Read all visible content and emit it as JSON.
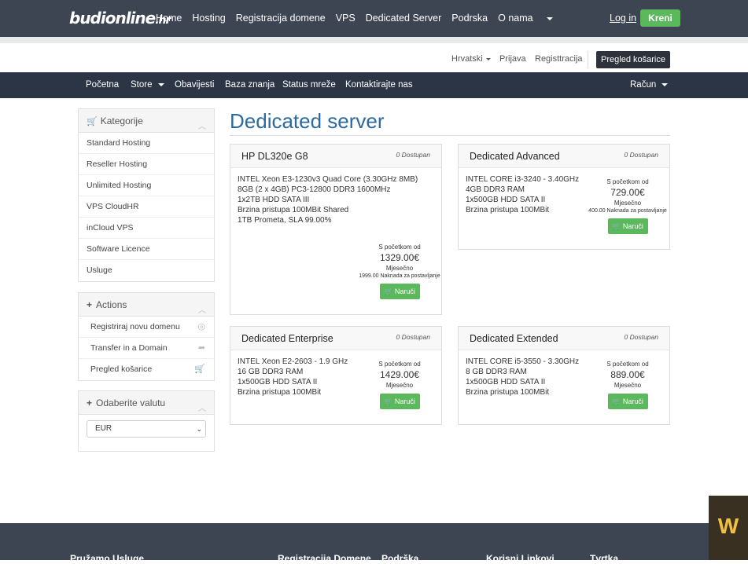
{
  "topnav": {
    "logo_main": "budionline",
    "logo_tld": ".hr",
    "menu": [
      "Home",
      "Hosting",
      "Registracija domene",
      "VPS",
      "Dedicated Server",
      "Podrska",
      "O nama"
    ],
    "login": "Log in",
    "cta": "Kreni"
  },
  "utilbar": {
    "language": "Hrvatski",
    "signin": "Prijava",
    "register": "Registtracija",
    "cart": "Pregled košarice"
  },
  "mainnav": {
    "items": [
      "Početna",
      "Store",
      "Obavijesti",
      "Baza znanja",
      "Status mreže",
      "Kontaktirajte nas"
    ],
    "account": "Račun"
  },
  "sidebar": {
    "categories_title": "Kategorije",
    "categories": [
      "Standard Hosting",
      "Reseller Hosting",
      "Unlimited Hosting",
      "VPS CloudHR",
      "inCloud VPS",
      "Software Licence",
      "Usluge"
    ],
    "actions_title": "Actions",
    "actions": [
      "Registriraj novu domenu",
      "Transfer in a Domain",
      "Pregled košarice"
    ],
    "currency_title": "Odaberite valutu",
    "currency_value": "EUR"
  },
  "page": {
    "title": "Dedicated server"
  },
  "products": [
    {
      "name": "HP DL320e G8",
      "available": "0 Dostupan",
      "desc": [
        "INTEL Xeon E3-1230v3 Quad Core (3.30GHz 8MB)",
        "8GB (2 x 4GB) PC3-12800 DDR3 1600MHz",
        "1x2TB HDD SATA III",
        "Brzina pristupa 100MBit Shared",
        "1TB Prometa, SLA 99.00%"
      ],
      "from": "S početkom od",
      "price": "1329.00€",
      "period": "Mjesečno",
      "setup": "1999.00 Naknada za postavljanje",
      "order": "Naruči"
    },
    {
      "name": "Dedicated Advanced",
      "available": "0 Dostupan",
      "desc": [
        "INTEL CORE i3-3240 - 3.40GHz",
        "4GB DDR3 RAM",
        "1x500GB HDD SATA II",
        "Brzina pristupa 100MBit"
      ],
      "from": "S početkom od",
      "price": "729.00€",
      "period": "Mjesečno",
      "setup": "400.00 Naknada za postavljanje",
      "order": "Naruči"
    },
    {
      "name": "Dedicated Enterprise",
      "available": "0 Dostupan",
      "desc": [
        "INTEL Xeon E2-2603 - 1.9 GHz",
        "16 GB DDR3 RAM",
        "1x500GB HDD SATA II",
        "Brzina pristupa 100MBit"
      ],
      "from": "S početkom od",
      "price": "1429.00€",
      "period": "Mjesečno",
      "order": "Naruči"
    },
    {
      "name": "Dedicated Extended",
      "available": "0 Dostupan",
      "desc": [
        "INTEL CORE i5-3550 - 3.30GHz",
        "8 GB DDR3 RAM",
        "1x500GB HDD SATA II",
        "Brzina pristupa 100MBit"
      ],
      "from": "S početkom od",
      "price": "889.00€",
      "period": "Mjesečno",
      "order": "Naruči"
    }
  ],
  "footer": {
    "cols": [
      "Pružamo Usluge",
      "Registracija Domene",
      "Podrška",
      "Korisni Linkovi",
      "Tvrtka"
    ]
  },
  "colors": {
    "topbar": "#3d4452",
    "mainnav": "#2c3545",
    "accent_green": "#5cb85c",
    "title_blue": "#2c6aa0"
  }
}
